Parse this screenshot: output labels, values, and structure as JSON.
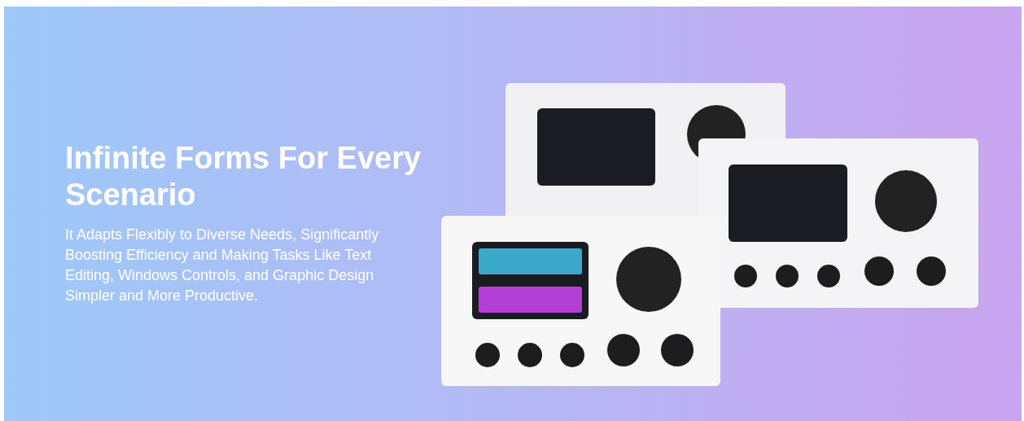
{
  "banner": {
    "title": "Infinite Forms For Every Scenario",
    "description": "It Adapts Flexibly to Diverse Needs, Significantly Boosting Efficiency and Making Tasks Like Text Editing, Windows Controls, and Graphic Design Simpler and More Productive."
  }
}
